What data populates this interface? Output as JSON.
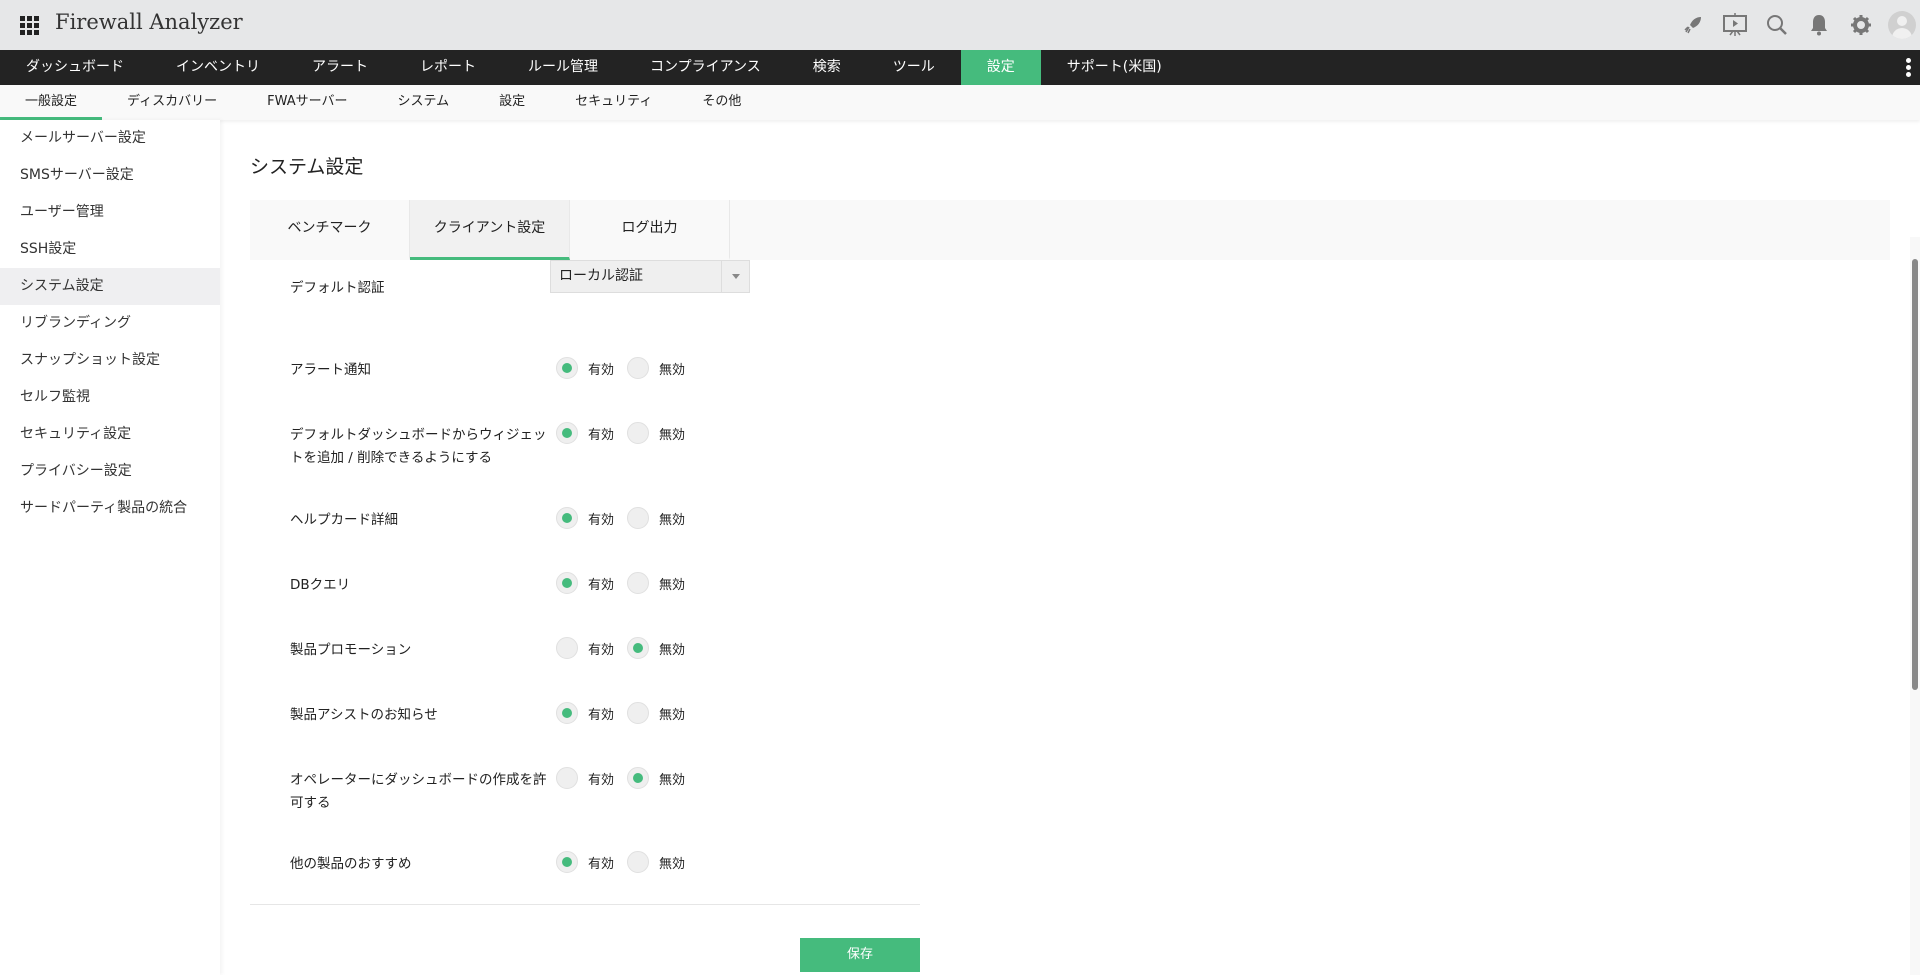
{
  "app": {
    "title": "Firewall Analyzer"
  },
  "header_icons": [
    "rocket-icon",
    "presentation-icon",
    "search-icon",
    "bell-icon",
    "gear-icon",
    "avatar"
  ],
  "main_nav": [
    {
      "label": "ダッシュボード",
      "active": false
    },
    {
      "label": "インベントリ",
      "active": false
    },
    {
      "label": "アラート",
      "active": false
    },
    {
      "label": "レポート",
      "active": false
    },
    {
      "label": "ルール管理",
      "active": false
    },
    {
      "label": "コンプライアンス",
      "active": false
    },
    {
      "label": "検索",
      "active": false
    },
    {
      "label": "ツール",
      "active": false
    },
    {
      "label": "設定",
      "active": true
    },
    {
      "label": "サポート(米国)",
      "active": false
    }
  ],
  "sub_nav": [
    {
      "label": "一般設定",
      "active": true
    },
    {
      "label": "ディスカバリー"
    },
    {
      "label": "FWAサーバー"
    },
    {
      "label": "システム"
    },
    {
      "label": "設定"
    },
    {
      "label": "セキュリティ"
    },
    {
      "label": "その他"
    }
  ],
  "sidebar": [
    {
      "label": "メールサーバー設定"
    },
    {
      "label": "SMSサーバー設定"
    },
    {
      "label": "ユーザー管理"
    },
    {
      "label": "SSH設定"
    },
    {
      "label": "システム設定",
      "active": true
    },
    {
      "label": "リブランディング"
    },
    {
      "label": "スナップショット設定"
    },
    {
      "label": "セルフ監視"
    },
    {
      "label": "セキュリティ設定"
    },
    {
      "label": "プライバシー設定"
    },
    {
      "label": "サードパーティ製品の統合"
    }
  ],
  "page": {
    "title": "システム設定",
    "tabs": [
      {
        "label": "ベンチマーク"
      },
      {
        "label": "クライアント設定",
        "active": true
      },
      {
        "label": "ログ出力"
      }
    ],
    "default_auth": {
      "label": "デフォルト認証",
      "value": "ローカル認証"
    },
    "enable_label": "有効",
    "disable_label": "無効",
    "settings": [
      {
        "label": "アラート通知",
        "enabled": true
      },
      {
        "label": "デフォルトダッシュボードからウィジェットを追加 / 削除できるようにする",
        "enabled": true
      },
      {
        "label": "ヘルプカード詳細",
        "enabled": true
      },
      {
        "label": "DBクエリ",
        "enabled": true
      },
      {
        "label": "製品プロモーション",
        "enabled": false
      },
      {
        "label": "製品アシストのお知らせ",
        "enabled": true
      },
      {
        "label": "オペレーターにダッシュボードの作成を許可する",
        "enabled": false
      },
      {
        "label": "他の製品のおすすめ",
        "enabled": true
      }
    ],
    "save_label": "保存"
  },
  "colors": {
    "accent": "#45bb7d",
    "nav_bg": "#232323",
    "header_bg": "#e6e7e8"
  }
}
